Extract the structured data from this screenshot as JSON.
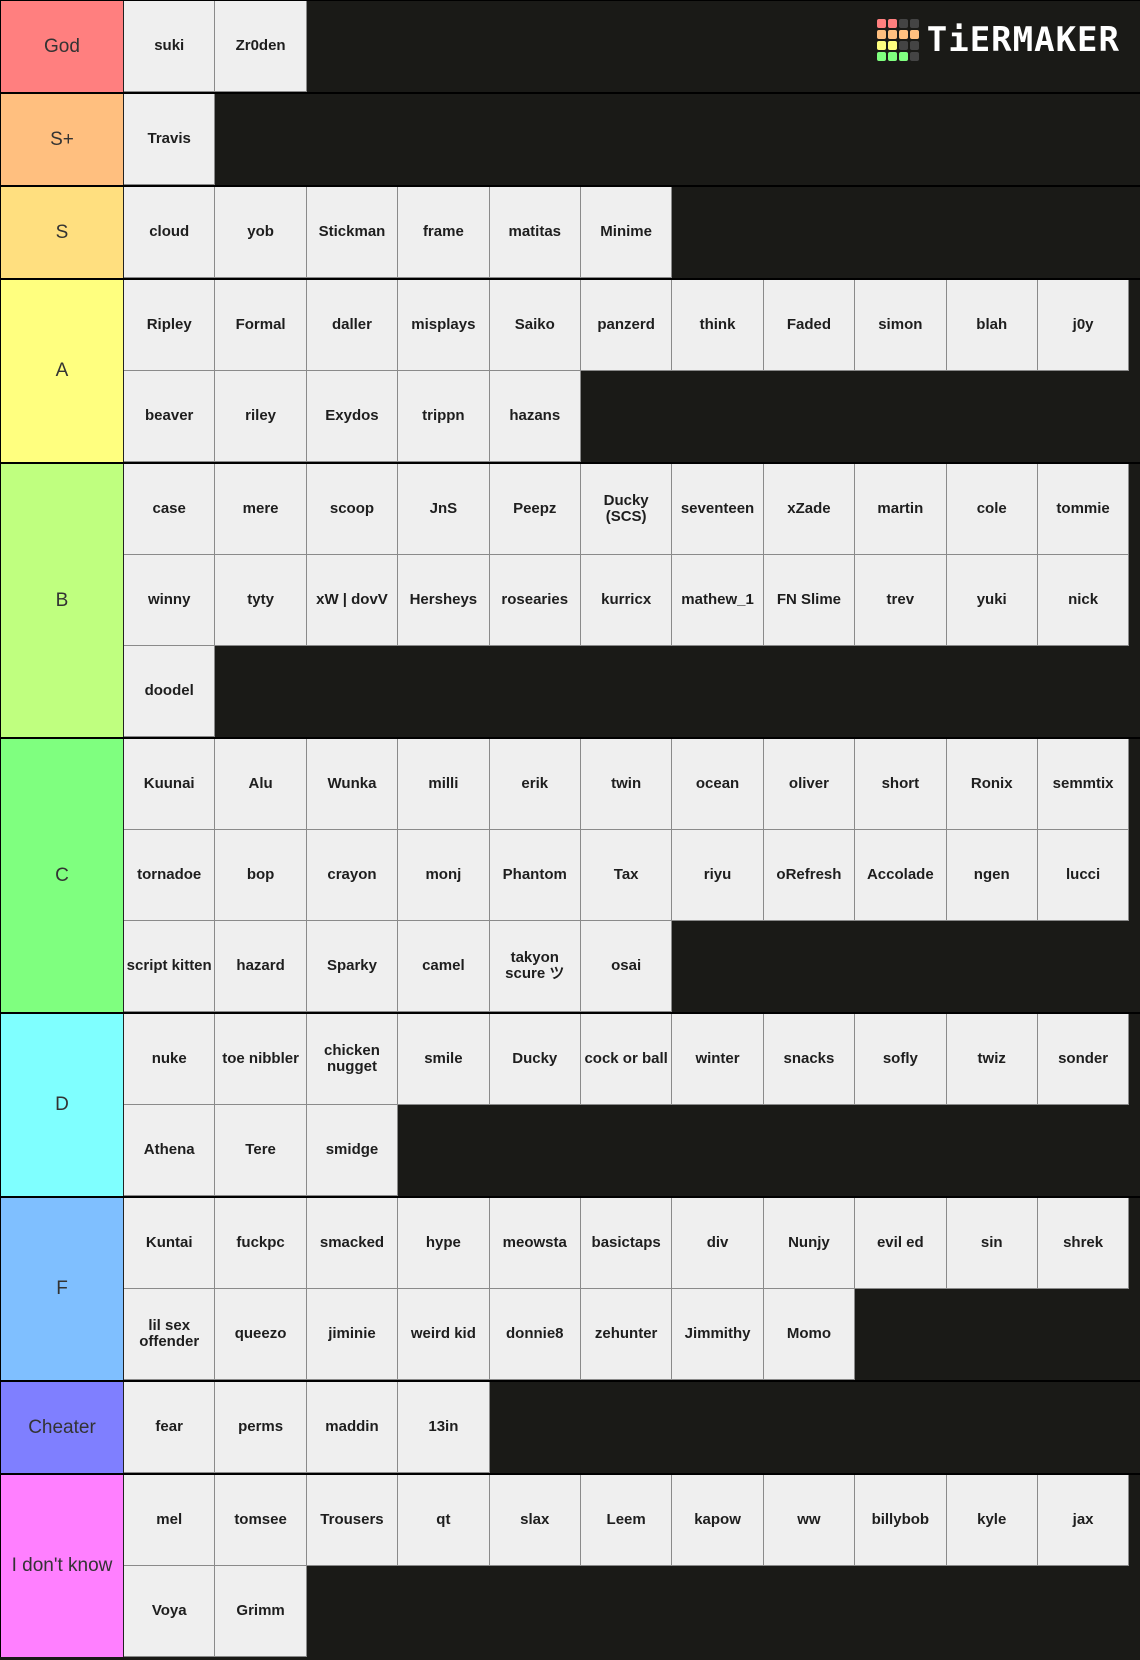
{
  "logo": {
    "text": "TiERMAKER",
    "grid_colors": [
      "#ff7f7f",
      "#ff7f7f",
      "#444444",
      "#444444",
      "#ffbf7f",
      "#ffbf7f",
      "#ffbf7f",
      "#ffbf7f",
      "#ffff7f",
      "#ffff7f",
      "#444444",
      "#444444",
      "#7fff7f",
      "#7fff7f",
      "#7fff7f",
      "#444444"
    ]
  },
  "tiers": [
    {
      "label": "God",
      "color": "#ff7f7f",
      "items": [
        "suki",
        "Zr0den"
      ]
    },
    {
      "label": "S+",
      "color": "#ffbf7f",
      "items": [
        "Travis"
      ]
    },
    {
      "label": "S",
      "color": "#ffdf7f",
      "items": [
        "cloud",
        "yob",
        "Stickman",
        "frame",
        "matitas",
        "Minime"
      ]
    },
    {
      "label": "A",
      "color": "#ffff7f",
      "items": [
        "Ripley",
        "Formal",
        "daller",
        "misplays",
        "Saiko",
        "panzerd",
        "think",
        "Faded",
        "simon",
        "blah",
        "j0y",
        "beaver",
        "riley",
        "Exydos",
        "trippn",
        "hazans"
      ]
    },
    {
      "label": "B",
      "color": "#bfff7f",
      "items": [
        "case",
        "mere",
        "scoop",
        "JnS",
        "Peepz",
        "Ducky (SCS)",
        "seventeen",
        "xZade",
        "martin",
        "cole",
        "tommie",
        "winny",
        "tyty",
        "xW | dovV",
        "Hersheys",
        "rosearies",
        "kurricx",
        "mathew_1",
        "FN Slime",
        "trev",
        "yuki",
        "nick",
        "doodel"
      ]
    },
    {
      "label": "C",
      "color": "#7fff7f",
      "items": [
        "Kuunai",
        "Alu",
        "Wunka",
        "milli",
        "erik",
        "twin",
        "ocean",
        "oliver",
        "short",
        "Ronix",
        "semmtix",
        "tornadoe",
        "bop",
        "crayon",
        "monj",
        "Phantom",
        "Tax",
        "riyu",
        "oRefresh",
        "Accolade",
        "ngen",
        "lucci",
        "script kitten",
        "hazard",
        "Sparky",
        "camel",
        "takyon scure ツ",
        "osai"
      ]
    },
    {
      "label": "D",
      "color": "#7fffff",
      "items": [
        "nuke",
        "toe nibbler",
        "chicken nugget",
        "smile",
        "Ducky",
        "cock or ball",
        "winter",
        "snacks",
        "sofly",
        "twiz",
        "sonder",
        "Athena",
        "Tere",
        "smidge"
      ]
    },
    {
      "label": "F",
      "color": "#7fbfff",
      "items": [
        "Kuntai",
        "fuckpc",
        "smacked",
        "hype",
        "meowsta",
        "basictaps",
        "div",
        "Nunjy",
        "evil ed",
        "sin",
        "shrek",
        "lil sex offender",
        "queezo",
        "jiminie",
        "weird kid",
        "donnie8",
        "zehunter",
        "Jimmithy",
        "Momo"
      ]
    },
    {
      "label": "Cheater",
      "color": "#7f7fff",
      "items": [
        "fear",
        "perms",
        "maddin",
        "13in"
      ]
    },
    {
      "label": "I don't know",
      "color": "#ff7fff",
      "items": [
        "mel",
        "tomsee",
        "Trousers",
        "qt",
        "slax",
        "Leem",
        "kapow",
        "ww",
        "billybob",
        "kyle",
        "jax",
        "Voya",
        "Grimm"
      ]
    }
  ]
}
